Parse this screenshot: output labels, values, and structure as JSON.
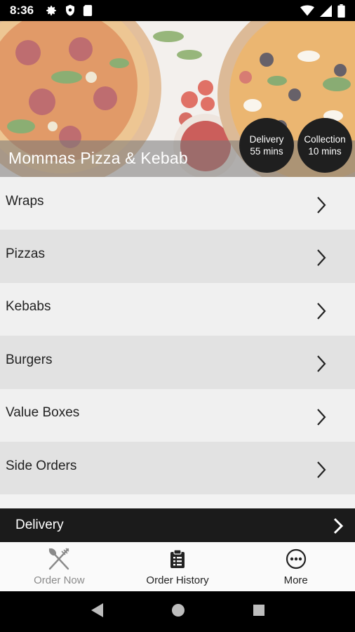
{
  "status_bar": {
    "time": "8:36",
    "icons": [
      "gear-icon",
      "shield-icon",
      "sim-card-icon",
      "wifi-icon",
      "signal-icon",
      "battery-icon"
    ]
  },
  "hero": {
    "restaurant_name": "Mommas Pizza & Kebab",
    "delivery_badge": {
      "label": "Delivery",
      "time": "55 mins"
    },
    "collection_badge": {
      "label": "Collection",
      "time": "10 mins"
    }
  },
  "menu": {
    "categories": [
      "Wraps",
      "Pizzas",
      "Kebabs",
      "Burgers",
      "Value Boxes",
      "Side Orders"
    ]
  },
  "order_bar": {
    "mode_label": "Delivery"
  },
  "tabs": [
    {
      "label": "Order Now",
      "icon": "fork-knife-icon"
    },
    {
      "label": "Order History",
      "icon": "clipboard-icon"
    },
    {
      "label": "More",
      "icon": "more-dots-icon"
    }
  ],
  "nav_bar": {
    "icons": [
      "back-icon",
      "home-icon",
      "recents-icon"
    ]
  },
  "colors": {
    "bar_dark": "#1b1b1b",
    "row_light": "#f0f0f0",
    "row_dark": "#e2e2e2",
    "tab_bg": "#fafafa"
  }
}
